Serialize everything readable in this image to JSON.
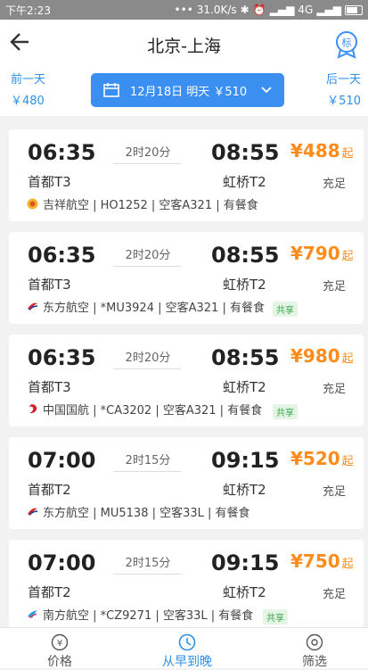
{
  "status": {
    "time": "下午2:23",
    "speed": "31.0K/s",
    "network": "4G"
  },
  "header": {
    "title": "北京-上海",
    "badge_text": "标"
  },
  "date_bar": {
    "prev_label": "前一天",
    "prev_price": "￥480",
    "selected": "12月18日 明天 ￥510",
    "next_label": "后一天",
    "next_price": "￥510"
  },
  "flights": [
    {
      "dep": "06:35",
      "arr": "08:55",
      "dur": "2时20分",
      "price": "¥488",
      "qi": "起",
      "dep_ap": "首都T3",
      "arr_ap": "虹桥T2",
      "seats": "充足",
      "info": "吉祥航空 | HO1252 | 空客A321 | 有餐食",
      "share": ""
    },
    {
      "dep": "06:35",
      "arr": "08:55",
      "dur": "2时20分",
      "price": "¥790",
      "qi": "起",
      "dep_ap": "首都T3",
      "arr_ap": "虹桥T2",
      "seats": "充足",
      "info": "东方航空 | *MU3924 | 空客A321 | 有餐食",
      "share": "共享"
    },
    {
      "dep": "06:35",
      "arr": "08:55",
      "dur": "2时20分",
      "price": "¥980",
      "qi": "起",
      "dep_ap": "首都T3",
      "arr_ap": "虹桥T2",
      "seats": "充足",
      "info": "中国国航 | *CA3202 | 空客A321 | 有餐食",
      "share": "共享"
    },
    {
      "dep": "07:00",
      "arr": "09:15",
      "dur": "2时15分",
      "price": "¥520",
      "qi": "起",
      "dep_ap": "首都T2",
      "arr_ap": "虹桥T2",
      "seats": "充足",
      "info": "东方航空 | MU5138 | 空客33L | 有餐食",
      "share": ""
    },
    {
      "dep": "07:00",
      "arr": "09:15",
      "dur": "2时15分",
      "price": "¥750",
      "qi": "起",
      "dep_ap": "首都T2",
      "arr_ap": "虹桥T2",
      "seats": "充足",
      "info": "南方航空 | *CZ9271 | 空客33L | 有餐食",
      "share": "共享"
    }
  ],
  "nav": {
    "price": "价格",
    "time": "从早到晚",
    "filter": "筛选"
  },
  "colors": {
    "accent": "#3b8ff0",
    "price": "#ff8c1a"
  }
}
